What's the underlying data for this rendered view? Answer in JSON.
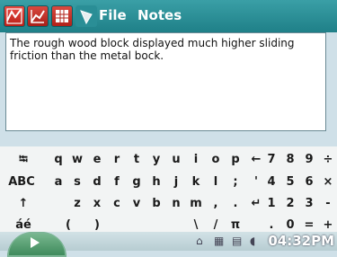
{
  "menu": {
    "file": "File",
    "notes": "Notes"
  },
  "note": {
    "text": "The rough wood block displayed much higher sliding friction than the metal bock."
  },
  "keyboard": {
    "row1": [
      "⭾",
      "q",
      "w",
      "e",
      "r",
      "t",
      "y",
      "u",
      "i",
      "o",
      "p",
      "←",
      "7",
      "8",
      "9",
      "÷"
    ],
    "row2": [
      "ABC",
      "a",
      "s",
      "d",
      "f",
      "g",
      "h",
      "j",
      "k",
      "l",
      ";",
      "'",
      "4",
      "5",
      "6",
      "×"
    ],
    "row3": [
      "↑",
      "z",
      "x",
      "c",
      "v",
      "b",
      "n",
      "m",
      ",",
      ".",
      "↵",
      "1",
      "2",
      "3",
      "-"
    ],
    "row4": [
      "áé",
      "(",
      ")",
      "\\",
      "/",
      "π",
      ".",
      "0",
      "=",
      "+"
    ]
  },
  "statusbar": {
    "clock": "04:32PM"
  },
  "icons": [
    "color-chart-icon",
    "line-chart-icon",
    "table-icon",
    "diamond-icon",
    "home-icon",
    "grid-icon",
    "keyboard-icon",
    "volume-icon"
  ]
}
